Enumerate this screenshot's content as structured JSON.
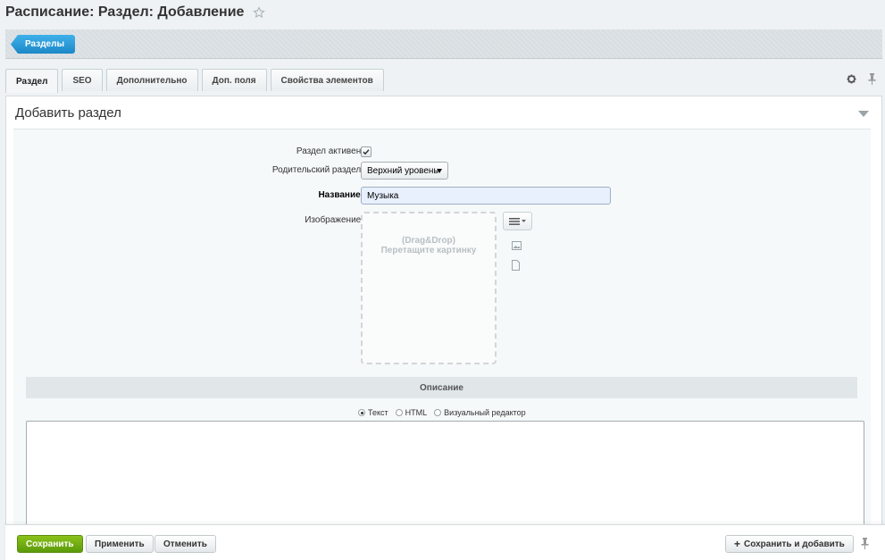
{
  "header": {
    "title": "Расписание: Раздел: Добавление"
  },
  "context": {
    "back_label": "Разделы"
  },
  "tabs": [
    {
      "label": "Раздел",
      "active": true
    },
    {
      "label": "SEO",
      "active": false
    },
    {
      "label": "Дополнительно",
      "active": false
    },
    {
      "label": "Доп. поля",
      "active": false
    },
    {
      "label": "Свойства элементов",
      "active": false
    }
  ],
  "panel": {
    "title": "Добавить раздел"
  },
  "form": {
    "active_label": "Раздел активен:",
    "active_checked": true,
    "parent_label": "Родительский раздел:",
    "parent_value": "Верхний уровень",
    "name_label": "Название:",
    "name_value": "Музыка",
    "image_label": "Изображение:",
    "dropzone_line1": "(Drag&Drop)",
    "dropzone_line2": "Перетащите картинку"
  },
  "description": {
    "section_title": "Описание",
    "options": [
      {
        "label": "Текст",
        "selected": true
      },
      {
        "label": "HTML",
        "selected": false
      },
      {
        "label": "Визуальный редактор",
        "selected": false
      }
    ]
  },
  "footer": {
    "save": "Сохранить",
    "apply": "Применить",
    "cancel": "Отменить",
    "save_add": "Сохранить и добавить"
  },
  "colors": {
    "accent_blue": "#2a9be0",
    "save_green": "#72ac12"
  }
}
